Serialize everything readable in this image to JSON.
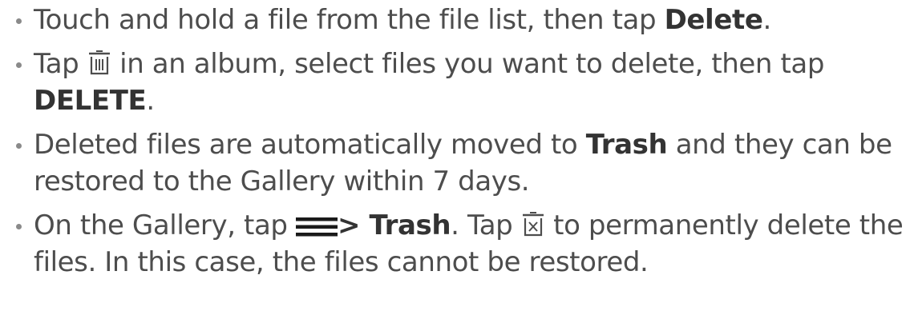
{
  "items": [
    {
      "t1": "Touch and hold a file from the file list, then tap ",
      "b1": "Delete",
      "t2": "."
    },
    {
      "t1": "Tap ",
      "icon": "trash-icon",
      "t2": " in an album, select files you want to delete, then tap ",
      "b1": "DELETE",
      "t3": "."
    },
    {
      "t1": "Deleted files are automatically moved to ",
      "b1": "Trash",
      "t2": " and they can be restored to the Gallery within 7 days."
    },
    {
      "t1": "On the Gallery, tap ",
      "icon1": "menu-icon",
      "b1": "> Trash",
      "t2": ". Tap ",
      "icon2": "trash-delete-icon",
      "t3": " to permanently delete the files. In this case, the files cannot be restored."
    }
  ]
}
